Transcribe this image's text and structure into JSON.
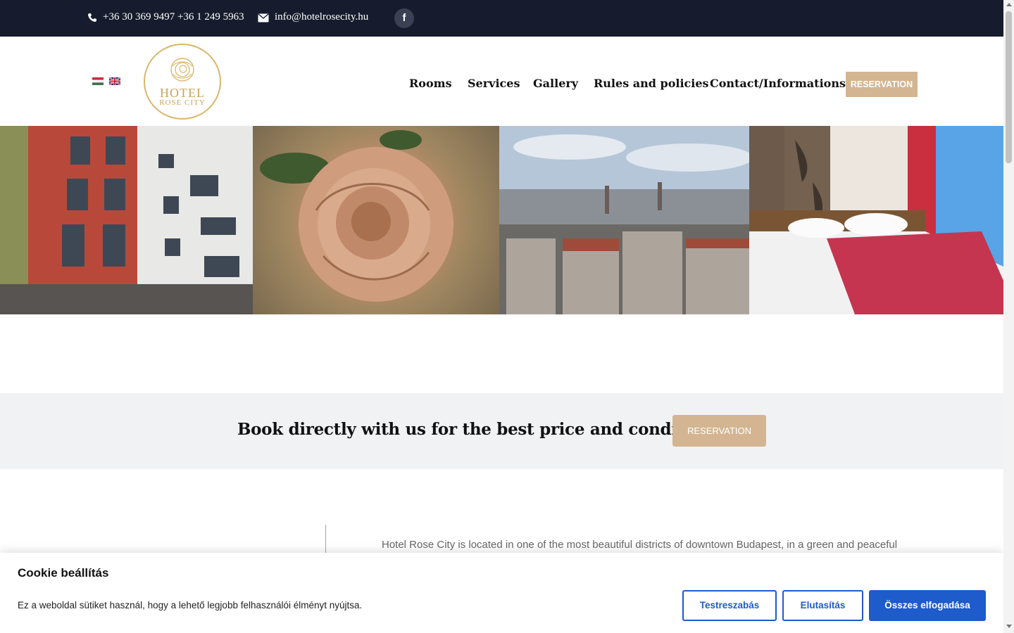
{
  "topbar": {
    "phones": "+36 30 369 9497  +36 1 249 5963",
    "email": "info@hotelrosecity.hu",
    "facebook_glyph": "f"
  },
  "header": {
    "languages": [
      "hu",
      "en"
    ],
    "logo": {
      "line1": "HOTEL",
      "line2": "ROSE CITY"
    },
    "nav": {
      "rooms": "Rooms",
      "services": "Services",
      "gallery": "Gallery",
      "rules": "Rules and policies",
      "contact": "Contact/Informations"
    },
    "reservation": "RESERVATION"
  },
  "band": {
    "text": "Book directly with us for the best price and conditions:",
    "button": "RESERVATION"
  },
  "intro": "Hotel Rose City is located in one of the most beautiful districts of downtown Budapest, in a green and peaceful",
  "cookie": {
    "title": "Cookie beállítás",
    "description": "Ez a weboldal sütiket használ, hogy a lehető legjobb felhasználói élményt nyújtsa.",
    "customize": "Testreszabás",
    "reject": "Elutasítás",
    "accept": "Összes elfogadása"
  },
  "colors": {
    "topbar": "#161c2d",
    "accent": "#d3b592",
    "cookie_blue": "#1e5bcb"
  }
}
